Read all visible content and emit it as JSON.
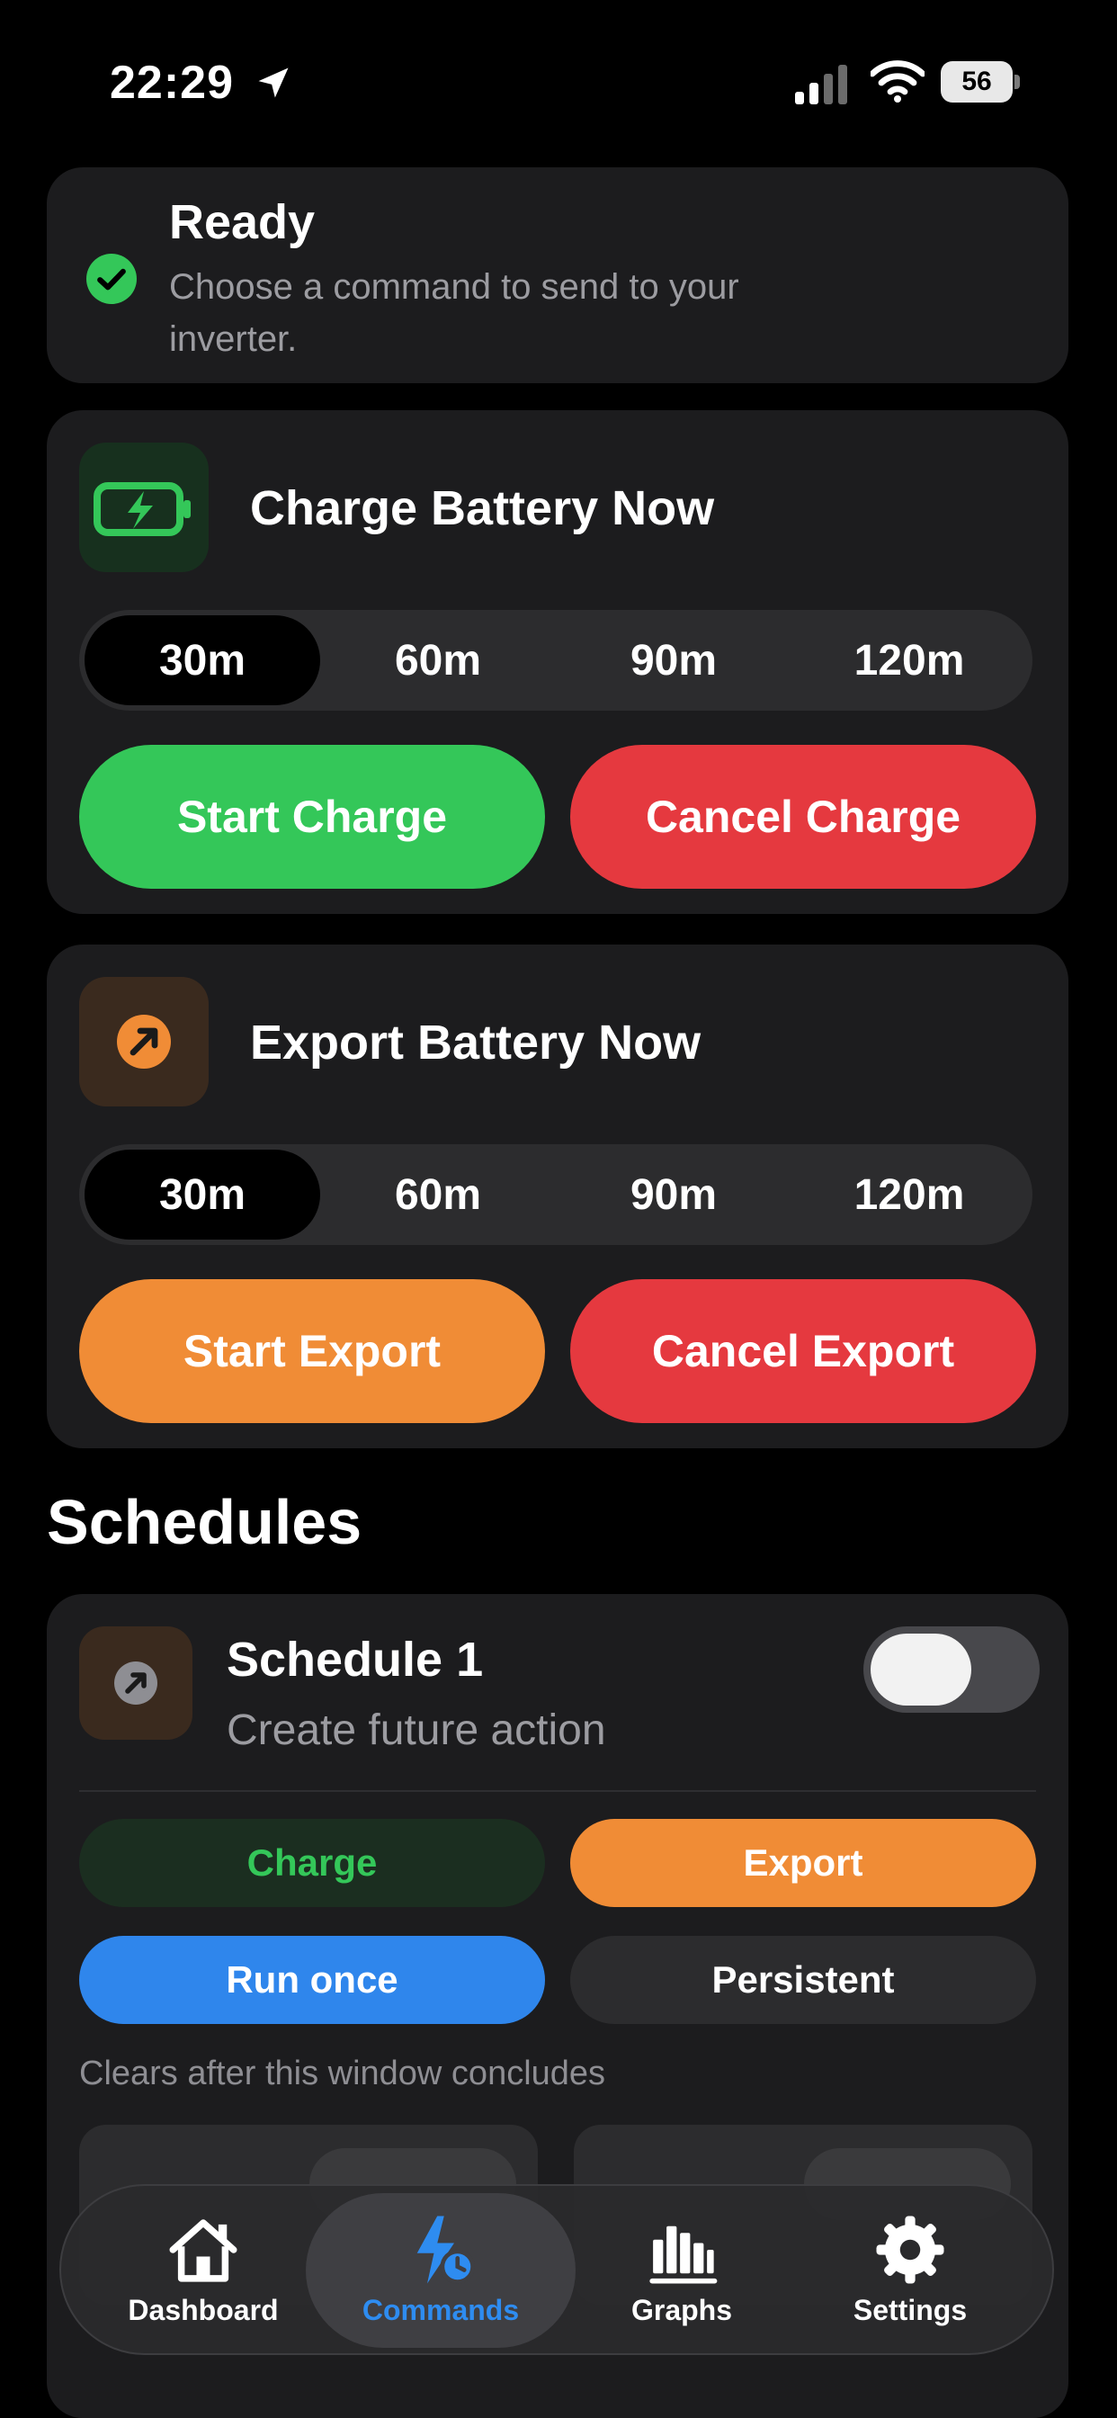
{
  "status_bar": {
    "time": "22:29",
    "battery_level": "56"
  },
  "ready": {
    "title": "Ready",
    "subtitle": "Choose a command to send to your inverter."
  },
  "charge": {
    "title": "Charge Battery Now",
    "durations": [
      "30m",
      "60m",
      "90m",
      "120m"
    ],
    "selected_duration": "30m",
    "start_label": "Start Charge",
    "cancel_label": "Cancel Charge",
    "icon": "battery-charging-icon"
  },
  "export": {
    "title": "Export Battery Now",
    "durations": [
      "30m",
      "60m",
      "90m",
      "120m"
    ],
    "selected_duration": "30m",
    "start_label": "Start Export",
    "cancel_label": "Cancel Export",
    "icon": "export-arrow-icon"
  },
  "schedules": {
    "section_title": "Schedules",
    "items": [
      {
        "title": "Schedule 1",
        "subtitle": "Create future action",
        "enabled": false,
        "mode_charge_label": "Charge",
        "mode_export_label": "Export",
        "selected_mode": "Export",
        "repeat_once_label": "Run once",
        "repeat_persistent_label": "Persistent",
        "selected_repeat": "Run once",
        "note": "Clears after this window concludes"
      }
    ]
  },
  "tab_bar": {
    "items": [
      {
        "label": "Dashboard",
        "icon": "house-icon"
      },
      {
        "label": "Commands",
        "icon": "bolt-clock-icon"
      },
      {
        "label": "Graphs",
        "icon": "bar-chart-icon"
      },
      {
        "label": "Settings",
        "icon": "gear-icon"
      }
    ],
    "active": "Commands"
  },
  "colors": {
    "green": "#34c759",
    "red": "#e5393f",
    "orange": "#f08c36",
    "blue": "#2f86ec",
    "card": "#1c1c1e"
  }
}
